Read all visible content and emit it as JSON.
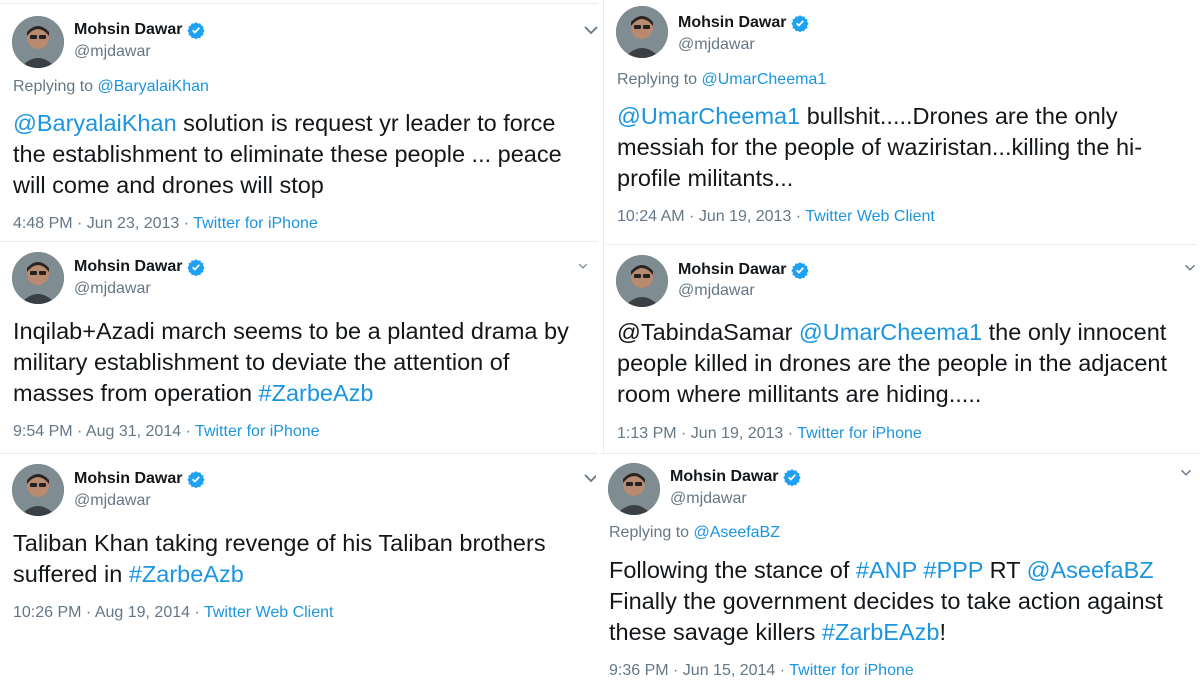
{
  "colors": {
    "link": "#1b95e0",
    "muted": "#657786",
    "text": "#14171a",
    "verified": "#1da1f2"
  },
  "icons": {
    "verified": "verified-badge-icon",
    "caret": "chevron-down-icon",
    "avatar": "profile-photo"
  },
  "author": {
    "name": "Mohsin Dawar",
    "handle": "@mjdawar"
  },
  "tweets": [
    {
      "reply_prefix": "Replying to ",
      "reply_to": "@BaryalaiKhan",
      "text_parts": [
        "@BaryalaiKhan",
        " solution is request yr leader to force the establishment to eliminate these people ... peace will come and drones will stop"
      ],
      "time": "4:48 PM · Jun 23, 2013 · ",
      "client": "Twitter for iPhone"
    },
    {
      "text_parts": [
        "Inqilab+Azadi march seems to be a planted drama by military establishment to deviate the attention of masses from operation ",
        "#ZarbeAzb"
      ],
      "time": "9:54 PM · Aug 31, 2014 · ",
      "client": "Twitter for iPhone"
    },
    {
      "text_parts": [
        "Taliban Khan taking revenge of his Taliban brothers suffered in ",
        "#ZarbeAzb"
      ],
      "time": "10:26 PM · Aug 19, 2014 · ",
      "client": "Twitter Web Client"
    },
    {
      "reply_prefix": "Replying to ",
      "reply_to": "@UmarCheema1",
      "text_parts": [
        "@UmarCheema1",
        " bullshit.....Drones are the only messiah for the people of waziristan...killing the hi-profile militants..."
      ],
      "time": "10:24 AM · Jun 19, 2013 · ",
      "client": "Twitter Web Client"
    },
    {
      "text_parts": [
        "@TabindaSamar ",
        "@UmarCheema1",
        " the only innocent people killed in drones are the people in the adjacent room where millitants are hiding....."
      ],
      "time": "1:13 PM · Jun 19, 2013 · ",
      "client": "Twitter for iPhone"
    },
    {
      "reply_prefix": "Replying to ",
      "reply_to": "@AseefaBZ",
      "text_parts": [
        "Following the stance of ",
        "#ANP",
        " ",
        "#PPP",
        " RT ",
        "@AseefaBZ",
        " Finally the government decides to take action against these savage killers ",
        "#ZarbEAzb",
        "!"
      ],
      "time": "9:36 PM · Jun 15, 2014 · ",
      "client": "Twitter for iPhone"
    }
  ]
}
